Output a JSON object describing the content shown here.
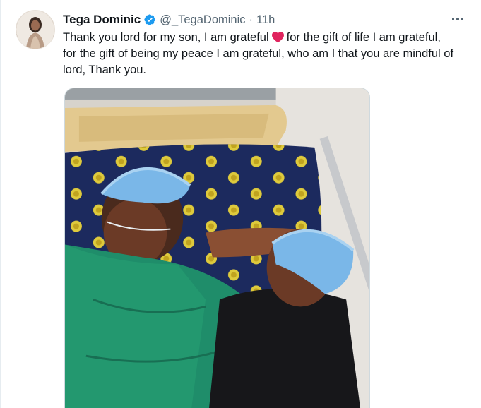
{
  "tweet": {
    "display_name": "Tega Dominic",
    "handle": "@_TegaDominic",
    "separator": "·",
    "time": "11h",
    "text_lines": [
      "Thank you lord for my son, I am grateful",
      "for the gift of life I am grateful,",
      "for the gift of being my peace I am grateful, who am I that you are mindful of",
      "lord, Thank you."
    ],
    "emoji": "red-heart",
    "media": {
      "alt": ""
    }
  },
  "icons": {
    "verified": "verified-badge-icon",
    "more": "more-options-icon"
  },
  "colors": {
    "verified": "#1d9bf0",
    "text": "#0f1419",
    "secondary": "#536471",
    "heart": "#e0245e",
    "pillow": "#1c2a5e",
    "gown": "#1f8d6a",
    "cap": "#7ab7e8"
  }
}
